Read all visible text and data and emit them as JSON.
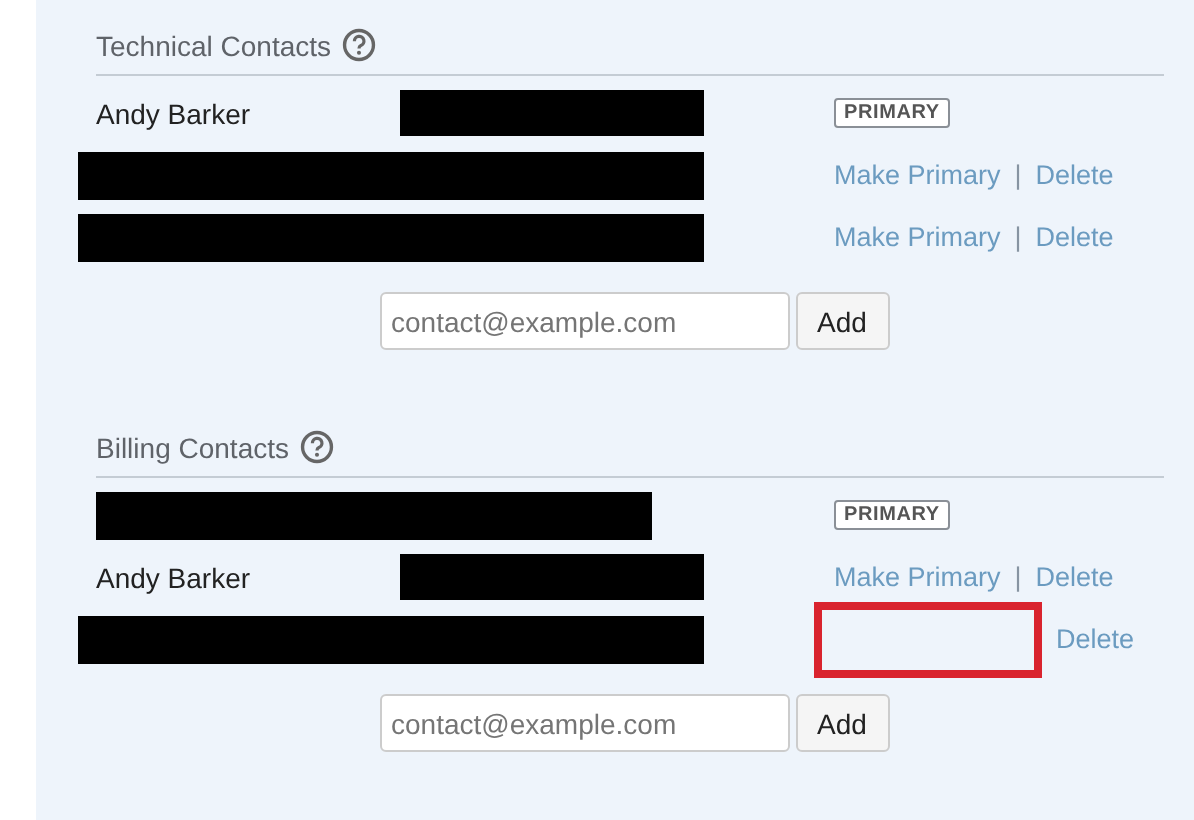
{
  "sections": [
    {
      "title": "Technical Contacts",
      "contacts": [
        {
          "kind": "named",
          "name": "Andy Barker",
          "primary": true,
          "badge": "PRIMARY"
        },
        {
          "kind": "redacted",
          "primary": false,
          "make_primary": "Make Primary",
          "separator": "|",
          "delete": "Delete"
        },
        {
          "kind": "redacted",
          "primary": false,
          "make_primary": "Make Primary",
          "separator": "|",
          "delete": "Delete"
        }
      ],
      "input": {
        "placeholder": "contact@example.com"
      },
      "add_button": "Add"
    },
    {
      "title": "Billing Contacts",
      "contacts": [
        {
          "kind": "redacted",
          "primary": true,
          "badge": "PRIMARY"
        },
        {
          "kind": "named",
          "name": "Andy Barker",
          "primary": false,
          "make_primary": "Make Primary",
          "separator": "|",
          "delete": "Delete"
        },
        {
          "kind": "redacted",
          "primary": false,
          "highlighted": true,
          "delete": "Delete"
        }
      ],
      "input": {
        "placeholder": "contact@example.com"
      },
      "add_button": "Add"
    }
  ]
}
